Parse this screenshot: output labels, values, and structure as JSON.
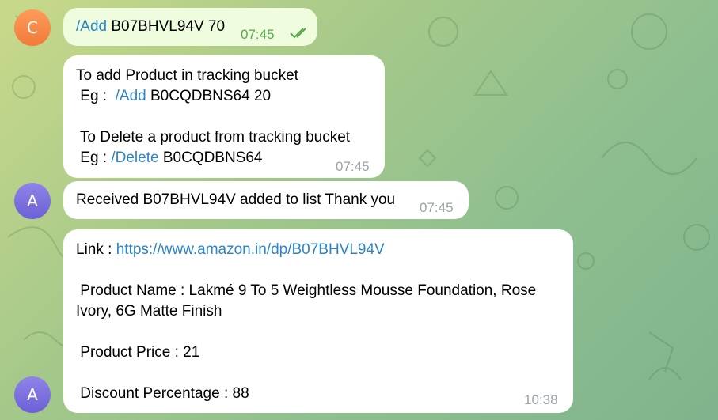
{
  "messages": [
    {
      "sender_initial": "C",
      "parts": [
        "/Add",
        " B07BHVL94V 70"
      ],
      "time": "07:45"
    },
    {
      "lines": [
        {
          "text": "To add Product in tracking bucket"
        },
        {
          "prefix": " Eg :  ",
          "cmd": "/Add",
          "rest": " B0CQDBNS64 20"
        },
        {
          "text": ""
        },
        {
          "text": " To Delete a product from tracking bucket"
        },
        {
          "prefix": " Eg : ",
          "cmd": "/Delete",
          "rest": " B0CQDBNS64"
        }
      ],
      "time": "07:45"
    },
    {
      "sender_initial": "A",
      "text": "Received B07BHVL94V added to list Thank you",
      "time": "07:45"
    },
    {
      "sender_initial": "A",
      "link_label": "Link : ",
      "link": "https://www.amazon.in/dp/B07BHVL94V",
      "product_name_line1": " Product Name : Lakmé 9 To 5 Weightless Mousse Foundation, Rose",
      "product_name_line2": "Ivory, 6G Matte Finish",
      "price": " Product Price : 21",
      "discount": " Discount Percentage : 88",
      "time": "10:38"
    }
  ],
  "colors": {
    "outgoing_bubble": "#effdde",
    "incoming_bubble": "#ffffff",
    "link": "#2a86c9",
    "read_check": "#58a84a",
    "avatar_c": "#f07a3a",
    "avatar_a": "#6c60d6"
  },
  "icons": {
    "read_status": "double-check-icon"
  }
}
